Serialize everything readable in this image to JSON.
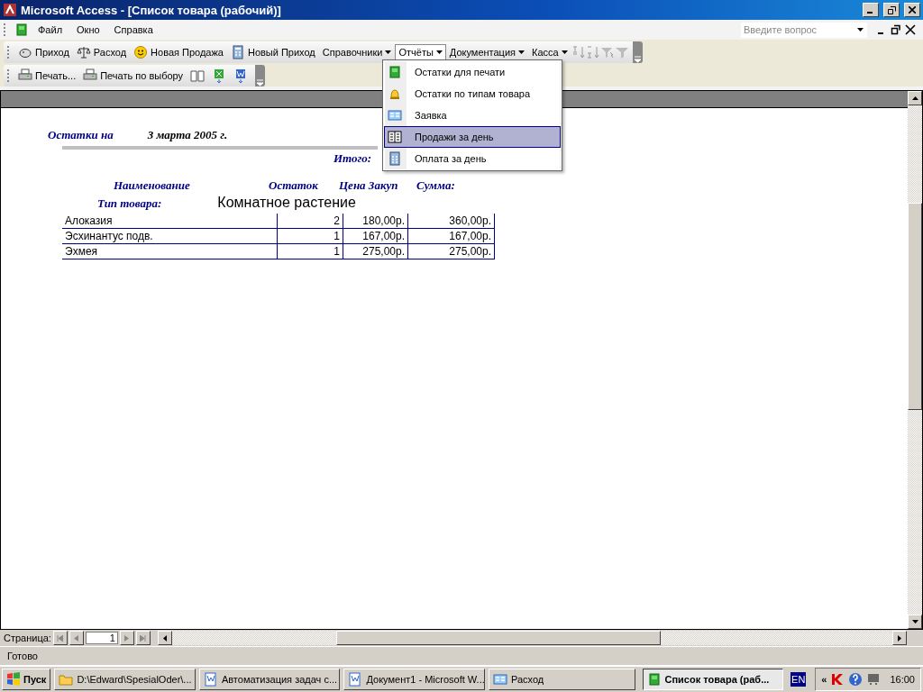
{
  "window": {
    "title": "Microsoft Access - [Список товара (рабочий)]"
  },
  "menu_bar": {
    "items": [
      "Файл",
      "Окно",
      "Справка"
    ],
    "help_search": {
      "placeholder": "Введите вопрос"
    }
  },
  "toolbar_main": [
    {
      "label": "Приход",
      "kind": "button",
      "expanded": false
    },
    {
      "label": "Расход",
      "kind": "button",
      "expanded": false
    },
    {
      "label": "Новая Продажа",
      "kind": "button",
      "expanded": false
    },
    {
      "label": "Новый Приход",
      "kind": "button",
      "expanded": false
    },
    {
      "label": "Справочники",
      "kind": "dropdown",
      "expanded": false
    },
    {
      "label": "Отчёты",
      "kind": "dropdown",
      "expanded": true
    },
    {
      "label": "Документация",
      "kind": "dropdown",
      "expanded": false
    },
    {
      "label": "Касса",
      "kind": "dropdown",
      "expanded": false
    }
  ],
  "toolbar_print": [
    "Печать...",
    "Печать по выбору"
  ],
  "reports_menu": [
    {
      "label": "Остатки для печати",
      "selected": false
    },
    {
      "label": "Остатки по типам товара",
      "selected": false
    },
    {
      "label": "Заявка",
      "selected": false
    },
    {
      "label": "Продажи за день",
      "selected": true
    },
    {
      "label": "Оплата за день",
      "selected": false
    }
  ],
  "report": {
    "title": "Остатки на",
    "date": "3 марта 2005 г.",
    "total_label": "Итого:",
    "columns": [
      "Наименование",
      "Остаток",
      "Цена Закуп",
      "Сумма:"
    ],
    "group_label": "Тип товара:",
    "group_value": "Комнатное растение",
    "rows": [
      {
        "name": "Алоказия",
        "qty": "2",
        "price": "180,00р.",
        "sum": "360,00р."
      },
      {
        "name": "Эсхинантус подв.",
        "qty": "1",
        "price": "167,00р.",
        "sum": "167,00р."
      },
      {
        "name": "Эхмея",
        "qty": "1",
        "price": "275,00р.",
        "sum": "275,00р."
      }
    ]
  },
  "page_nav": {
    "label": "Страница:",
    "value": "1"
  },
  "status_bar": {
    "text": "Готово"
  },
  "taskbar": {
    "start": "Пуск",
    "tasks": [
      {
        "label": "D:\\Edward\\SpesialOder\\...",
        "selected": false
      },
      {
        "label": "Автоматизация задач с...",
        "selected": false
      },
      {
        "label": "Документ1 - Microsoft W...",
        "selected": false
      },
      {
        "label": "Расход",
        "selected": false
      },
      {
        "label": "Список товара (раб...",
        "selected": true
      }
    ],
    "language": "EN",
    "tray_expand": "«",
    "clock": "16:00"
  }
}
